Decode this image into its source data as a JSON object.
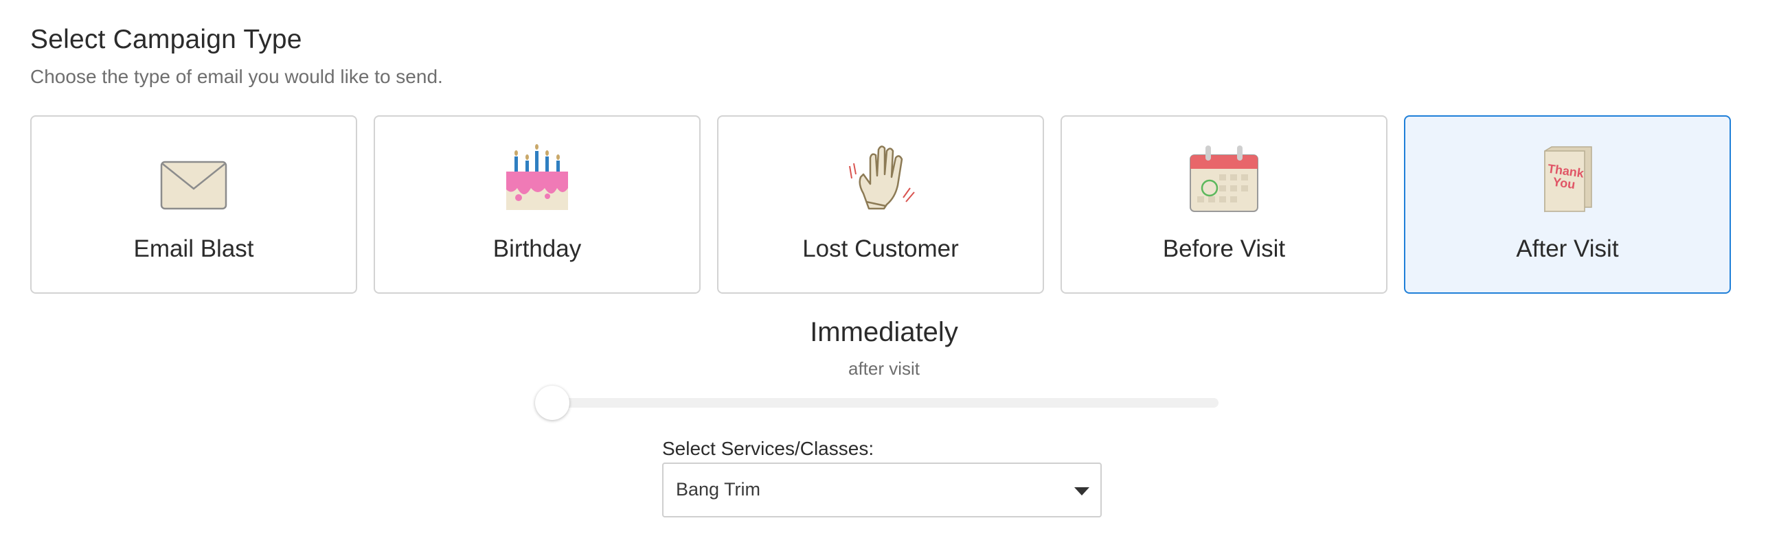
{
  "header": {
    "title": "Select Campaign Type",
    "subtitle": "Choose the type of email you would like to send."
  },
  "campaign_types": [
    {
      "label": "Email Blast",
      "icon": "envelope-icon",
      "selected": false
    },
    {
      "label": "Birthday",
      "icon": "birthday-cake-icon",
      "selected": false
    },
    {
      "label": "Lost Customer",
      "icon": "waving-hand-icon",
      "selected": false
    },
    {
      "label": "Before Visit",
      "icon": "calendar-icon",
      "selected": false
    },
    {
      "label": "After Visit",
      "icon": "thank-you-card-icon",
      "selected": true,
      "card_text": "Thank You"
    }
  ],
  "timing": {
    "value": "Immediately",
    "sub": "after visit",
    "slider_position": 0.0
  },
  "services": {
    "label": "Select Services/Classes:",
    "selected": "Bang Trim"
  },
  "colors": {
    "selected_border": "#1f7fd8",
    "selected_background": "#edf4fd",
    "card_border": "#d3d3d3",
    "cake_frosting": "#f07ab6",
    "candle": "#2f7fc1",
    "calendar_header": "#e8666a",
    "thank_you_text": "#e05566"
  }
}
